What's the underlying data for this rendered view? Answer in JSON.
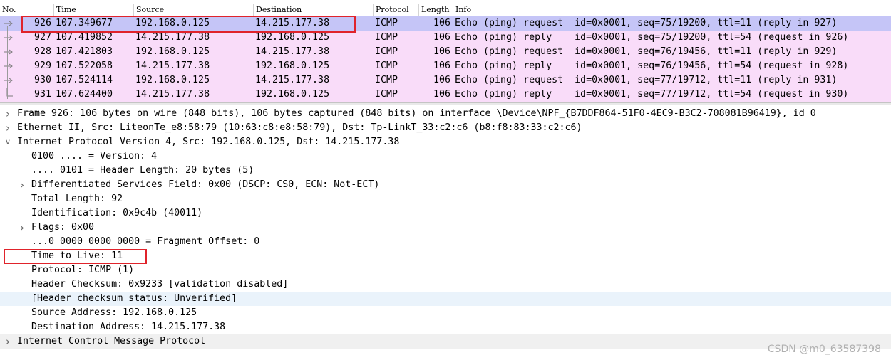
{
  "packet_list": {
    "columns": [
      "No.",
      "Time",
      "Source",
      "Destination",
      "Protocol",
      "Length",
      "Info"
    ],
    "rows": [
      {
        "no": "926",
        "time": "107.349677",
        "source": "192.168.0.125",
        "destination": "14.215.177.38",
        "protocol": "ICMP",
        "length": "106",
        "info": "Echo (ping) request  id=0x0001, seq=75/19200, ttl=11 (reply in 927)",
        "selected": true
      },
      {
        "no": "927",
        "time": "107.419852",
        "source": "14.215.177.38",
        "destination": "192.168.0.125",
        "protocol": "ICMP",
        "length": "106",
        "info": "Echo (ping) reply    id=0x0001, seq=75/19200, ttl=54 (request in 926)",
        "selected": false
      },
      {
        "no": "928",
        "time": "107.421803",
        "source": "192.168.0.125",
        "destination": "14.215.177.38",
        "protocol": "ICMP",
        "length": "106",
        "info": "Echo (ping) request  id=0x0001, seq=76/19456, ttl=11 (reply in 929)",
        "selected": false
      },
      {
        "no": "929",
        "time": "107.522058",
        "source": "14.215.177.38",
        "destination": "192.168.0.125",
        "protocol": "ICMP",
        "length": "106",
        "info": "Echo (ping) reply    id=0x0001, seq=76/19456, ttl=54 (request in 928)",
        "selected": false
      },
      {
        "no": "930",
        "time": "107.524114",
        "source": "192.168.0.125",
        "destination": "14.215.177.38",
        "protocol": "ICMP",
        "length": "106",
        "info": "Echo (ping) request  id=0x0001, seq=77/19712, ttl=11 (reply in 931)",
        "selected": false
      },
      {
        "no": "931",
        "time": "107.624400",
        "source": "14.215.177.38",
        "destination": "192.168.0.125",
        "protocol": "ICMP",
        "length": "106",
        "info": "Echo (ping) reply    id=0x0001, seq=77/19712, ttl=54 (request in 930)",
        "selected": false
      }
    ]
  },
  "details": {
    "lines": [
      {
        "text": "Frame 926: 106 bytes on wire (848 bits), 106 bytes captured (848 bits) on interface \\Device\\NPF_{B7DDF864-51F0-4EC9-B3C2-708081B96419}, id 0",
        "indent": 0,
        "twisty": "collapsed"
      },
      {
        "text": "Ethernet II, Src: LiteonTe_e8:58:79 (10:63:c8:e8:58:79), Dst: Tp-LinkT_33:c2:c6 (b8:f8:83:33:c2:c6)",
        "indent": 0,
        "twisty": "collapsed"
      },
      {
        "text": "Internet Protocol Version 4, Src: 192.168.0.125, Dst: 14.215.177.38",
        "indent": 0,
        "twisty": "expanded"
      },
      {
        "text": "0100 .... = Version: 4",
        "indent": 1,
        "twisty": "none"
      },
      {
        "text": ".... 0101 = Header Length: 20 bytes (5)",
        "indent": 1,
        "twisty": "none"
      },
      {
        "text": "Differentiated Services Field: 0x00 (DSCP: CS0, ECN: Not-ECT)",
        "indent": 1,
        "twisty": "collapsed"
      },
      {
        "text": "Total Length: 92",
        "indent": 1,
        "twisty": "none"
      },
      {
        "text": "Identification: 0x9c4b (40011)",
        "indent": 1,
        "twisty": "none"
      },
      {
        "text": "Flags: 0x00",
        "indent": 1,
        "twisty": "collapsed"
      },
      {
        "text": "...0 0000 0000 0000 = Fragment Offset: 0",
        "indent": 1,
        "twisty": "none"
      },
      {
        "text": "Time to Live: 11",
        "indent": 1,
        "twisty": "none"
      },
      {
        "text": "Protocol: ICMP (1)",
        "indent": 1,
        "twisty": "none"
      },
      {
        "text": "Header Checksum: 0x9233 [validation disabled]",
        "indent": 1,
        "twisty": "none"
      },
      {
        "text": "[Header checksum status: Unverified]",
        "indent": 1,
        "twisty": "none",
        "generated": true
      },
      {
        "text": "Source Address: 192.168.0.125",
        "indent": 1,
        "twisty": "none"
      },
      {
        "text": "Destination Address: 14.215.177.38",
        "indent": 1,
        "twisty": "none"
      },
      {
        "text": "Internet Control Message Protocol",
        "indent": 0,
        "twisty": "collapsed"
      }
    ]
  },
  "watermark": "CSDN @m0_63587398",
  "colors": {
    "icmp_row": "#f9dcf9",
    "selected_row": "#c5c5f7",
    "annotation_box": "#e0232b",
    "generated_field": "#eaf3fb"
  },
  "icons": {
    "collapsed": "chevron-right-icon",
    "expanded": "chevron-down-icon",
    "request": "request-arrow-icon",
    "reply": "reply-arrow-icon"
  }
}
